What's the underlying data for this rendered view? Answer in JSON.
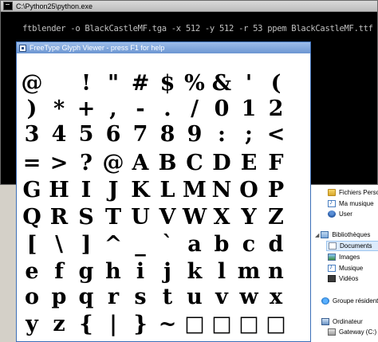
{
  "console": {
    "title": "C:\\Python25\\python.exe",
    "command": "ftblender -o BlackCastleMF.tga -x 512 -y 512 -r 53 ppem BlackCastleMF.ttf"
  },
  "viewer": {
    "title": "FreeType Glyph Viewer - press F1 for help",
    "rows": [
      [
        "@",
        "",
        "!",
        "\"",
        "#",
        "$",
        "%",
        "&",
        "'",
        "("
      ],
      [
        ")",
        "*",
        "+",
        ",",
        "-",
        ".",
        "/",
        "0",
        "1",
        "2"
      ],
      [
        "3",
        "4",
        "5",
        "6",
        "7",
        "8",
        "9",
        ":",
        ";",
        "<"
      ],
      [
        "=",
        ">",
        "?",
        "@",
        "A",
        "B",
        "C",
        "D",
        "E",
        "F"
      ],
      [
        "G",
        "H",
        "I",
        "J",
        "K",
        "L",
        "M",
        "N",
        "O",
        "P"
      ],
      [
        "Q",
        "R",
        "S",
        "T",
        "U",
        "V",
        "W",
        "X",
        "Y",
        "Z"
      ],
      [
        "[",
        "\\",
        "]",
        "^",
        "_",
        "`",
        "a",
        "b",
        "c",
        "d"
      ],
      [
        "e",
        "f",
        "g",
        "h",
        "i",
        "j",
        "k",
        "l",
        "m",
        "n"
      ],
      [
        "o",
        "p",
        "q",
        "r",
        "s",
        "t",
        "u",
        "v",
        "w",
        "x"
      ],
      [
        "y",
        "z",
        "{",
        "|",
        "}",
        "~",
        "□",
        "□",
        "□",
        "□"
      ]
    ]
  },
  "explorer": {
    "items": [
      {
        "label": "Fichiers Perso",
        "icon": "folder-icon"
      },
      {
        "label": "Ma musique",
        "icon": "music-icon"
      },
      {
        "label": "User",
        "icon": "user-icon"
      },
      {
        "label": "Bibliothèques",
        "icon": "libraries-icon"
      },
      {
        "label": "Documents",
        "icon": "documents-icon"
      },
      {
        "label": "Images",
        "icon": "images-icon"
      },
      {
        "label": "Musique",
        "icon": "music-icon"
      },
      {
        "label": "Vidéos",
        "icon": "videos-icon"
      },
      {
        "label": "Groupe résident",
        "icon": "homegroup-icon"
      },
      {
        "label": "Ordinateur",
        "icon": "computer-icon"
      },
      {
        "label": "Gateway (C:)",
        "icon": "drive-icon"
      }
    ]
  }
}
